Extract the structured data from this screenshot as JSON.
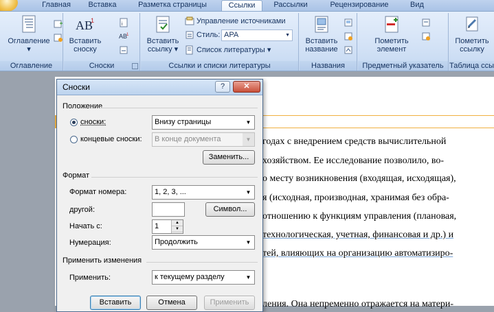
{
  "ribbon": {
    "tabs": [
      {
        "label": "Главная"
      },
      {
        "label": "Вставка"
      },
      {
        "label": "Разметка страницы"
      },
      {
        "label": "Ссылки"
      },
      {
        "label": "Рассылки"
      },
      {
        "label": "Рецензирование"
      },
      {
        "label": "Вид"
      }
    ],
    "groups": {
      "toc": {
        "label": "Оглавление",
        "btn_line1": "Оглавление",
        "btn_arrow": "▾"
      },
      "footnotes": {
        "label": "Сноски",
        "insert_line1": "Вставить",
        "insert_line2": "сноску"
      },
      "citations": {
        "label": "Ссылки и списки литературы",
        "insert_line1": "Вставить",
        "insert_line2": "ссылку ▾",
        "manage": "Управление источниками",
        "style_label": "Стиль:",
        "style_value": "APA",
        "bibliography": "Список литературы ▾"
      },
      "captions": {
        "label": "Названия",
        "insert_line1": "Вставить",
        "insert_line2": "название"
      },
      "index": {
        "label": "Предметный указатель",
        "mark_line1": "Пометить",
        "mark_line2": "элемент"
      },
      "toa": {
        "label": "Таблица ссы",
        "mark_line1": "Пометить",
        "mark_line2": "ссылку"
      }
    }
  },
  "document": {
    "lines": [
      "годах с внедрением средств вычислительной",
      "хозяйством. Ее исследование позволило, во-",
      "о месту возникновения (входящая, исходящая),",
      "я (исходная, производная, хранимая без обра-",
      "отношению к функциям управления (плановая,",
      "технологическая, учетная, финансовая и др.) и",
      "тей, влияющих на организацию автоматизиро-",
      "",
      "ления. Она непременно отражается на матери-"
    ]
  },
  "dialog": {
    "title": "Сноски",
    "help": "?",
    "close": "✕",
    "position": {
      "section": "Положение",
      "footnotes_label": "сноски:",
      "footnotes_value": "Внизу страницы",
      "endnotes_label": "концевые сноски:",
      "endnotes_value": "В конце документа",
      "replace_button": "Заменить..."
    },
    "format": {
      "section": "Формат",
      "number_format_label": "Формат номера:",
      "number_format_value": "1, 2, 3, ...",
      "custom_label": "другой:",
      "custom_value": "",
      "symbol_button": "Символ...",
      "start_label": "Начать с:",
      "start_value": "1",
      "numbering_label": "Нумерация:",
      "numbering_value": "Продолжить"
    },
    "apply": {
      "section": "Применить изменения",
      "apply_label": "Применить:",
      "apply_value": "к текущему разделу"
    },
    "buttons": {
      "insert": "Вставить",
      "cancel": "Отмена",
      "apply": "Применить"
    }
  }
}
